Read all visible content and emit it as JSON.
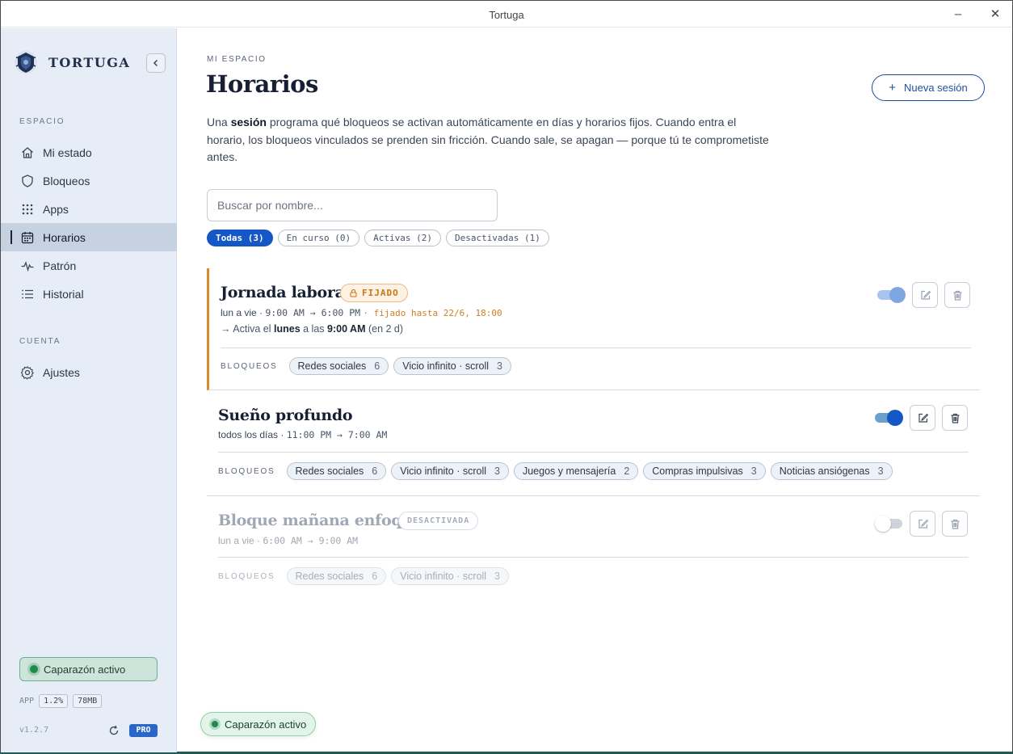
{
  "window": {
    "title": "Tortuga",
    "minimize": "–",
    "close": "✕"
  },
  "sidebar": {
    "brand": "TORTUGA",
    "section_space": "ESPACIO",
    "items": [
      {
        "label": "Mi estado",
        "icon": "home-icon"
      },
      {
        "label": "Bloqueos",
        "icon": "shield-icon"
      },
      {
        "label": "Apps",
        "icon": "grid-icon"
      },
      {
        "label": "Horarios",
        "icon": "calendar-icon",
        "active": true
      },
      {
        "label": "Patrón",
        "icon": "pulse-icon"
      },
      {
        "label": "Historial",
        "icon": "list-icon"
      }
    ],
    "section_account": "CUENTA",
    "settings": {
      "label": "Ajustes",
      "icon": "gear-icon"
    },
    "status": "Caparazón activo",
    "app_label": "APP",
    "cpu": "1.2%",
    "mem": "78MB",
    "version": "v1.2.7",
    "plan": "PRO"
  },
  "main": {
    "eyebrow": "MI ESPACIO",
    "title": "Horarios",
    "new_button": "Nueva sesión",
    "intro": {
      "p1": "Una ",
      "bold": "sesión",
      "p2": " programa qué bloqueos se activan automáticamente en días y horarios fijos. Cuando entra el horario, los bloqueos vinculados se prenden sin fricción. Cuando sale, se apagan — porque tú te comprometiste antes."
    },
    "search_placeholder": "Buscar por nombre...",
    "filters": [
      {
        "label": "Todas (3)",
        "active": true
      },
      {
        "label": "En curso (0)"
      },
      {
        "label": "Activas (2)"
      },
      {
        "label": "Desactivadas (1)"
      }
    ],
    "blocks_label": "BLOQUEOS",
    "sessions": [
      {
        "name": "Jornada laboral",
        "badge": "FIJADO",
        "days": "lun a vie",
        "time": "9:00 AM → 6:00 PM",
        "fixed_until": "fijado hasta 22/6, 18:00",
        "next": {
          "prefix": "→ Activa el ",
          "day": "lunes",
          "mid": " a las ",
          "time": "9:00 AM",
          "suffix": " (en 2 d)"
        },
        "enabled": true,
        "blocks": [
          {
            "name": "Redes sociales",
            "count": "6"
          },
          {
            "name": "Vicio infinito · scroll",
            "count": "3"
          }
        ]
      },
      {
        "name": "Sueño profundo",
        "days": "todos los días",
        "time": "11:00 PM → 7:00 AM",
        "enabled": true,
        "blocks": [
          {
            "name": "Redes sociales",
            "count": "6"
          },
          {
            "name": "Vicio infinito · scroll",
            "count": "3"
          },
          {
            "name": "Juegos y mensajería",
            "count": "2"
          },
          {
            "name": "Compras impulsivas",
            "count": "3"
          },
          {
            "name": "Noticias ansiógenas",
            "count": "3"
          }
        ]
      },
      {
        "name": "Bloque mañana enfoque",
        "badge": "DESACTIVADA",
        "days": "lun a vie",
        "time": "6:00 AM → 9:00 AM",
        "enabled": false,
        "blocks": [
          {
            "name": "Redes sociales",
            "count": "6"
          },
          {
            "name": "Vicio infinito · scroll",
            "count": "3"
          }
        ]
      }
    ],
    "status_pill": "Caparazón activo"
  },
  "colors": {
    "accent": "#1557c7",
    "fixed_orange": "#d98b2a",
    "active_green": "#1f8a4c",
    "sidebar_bg": "#e6edf7"
  }
}
